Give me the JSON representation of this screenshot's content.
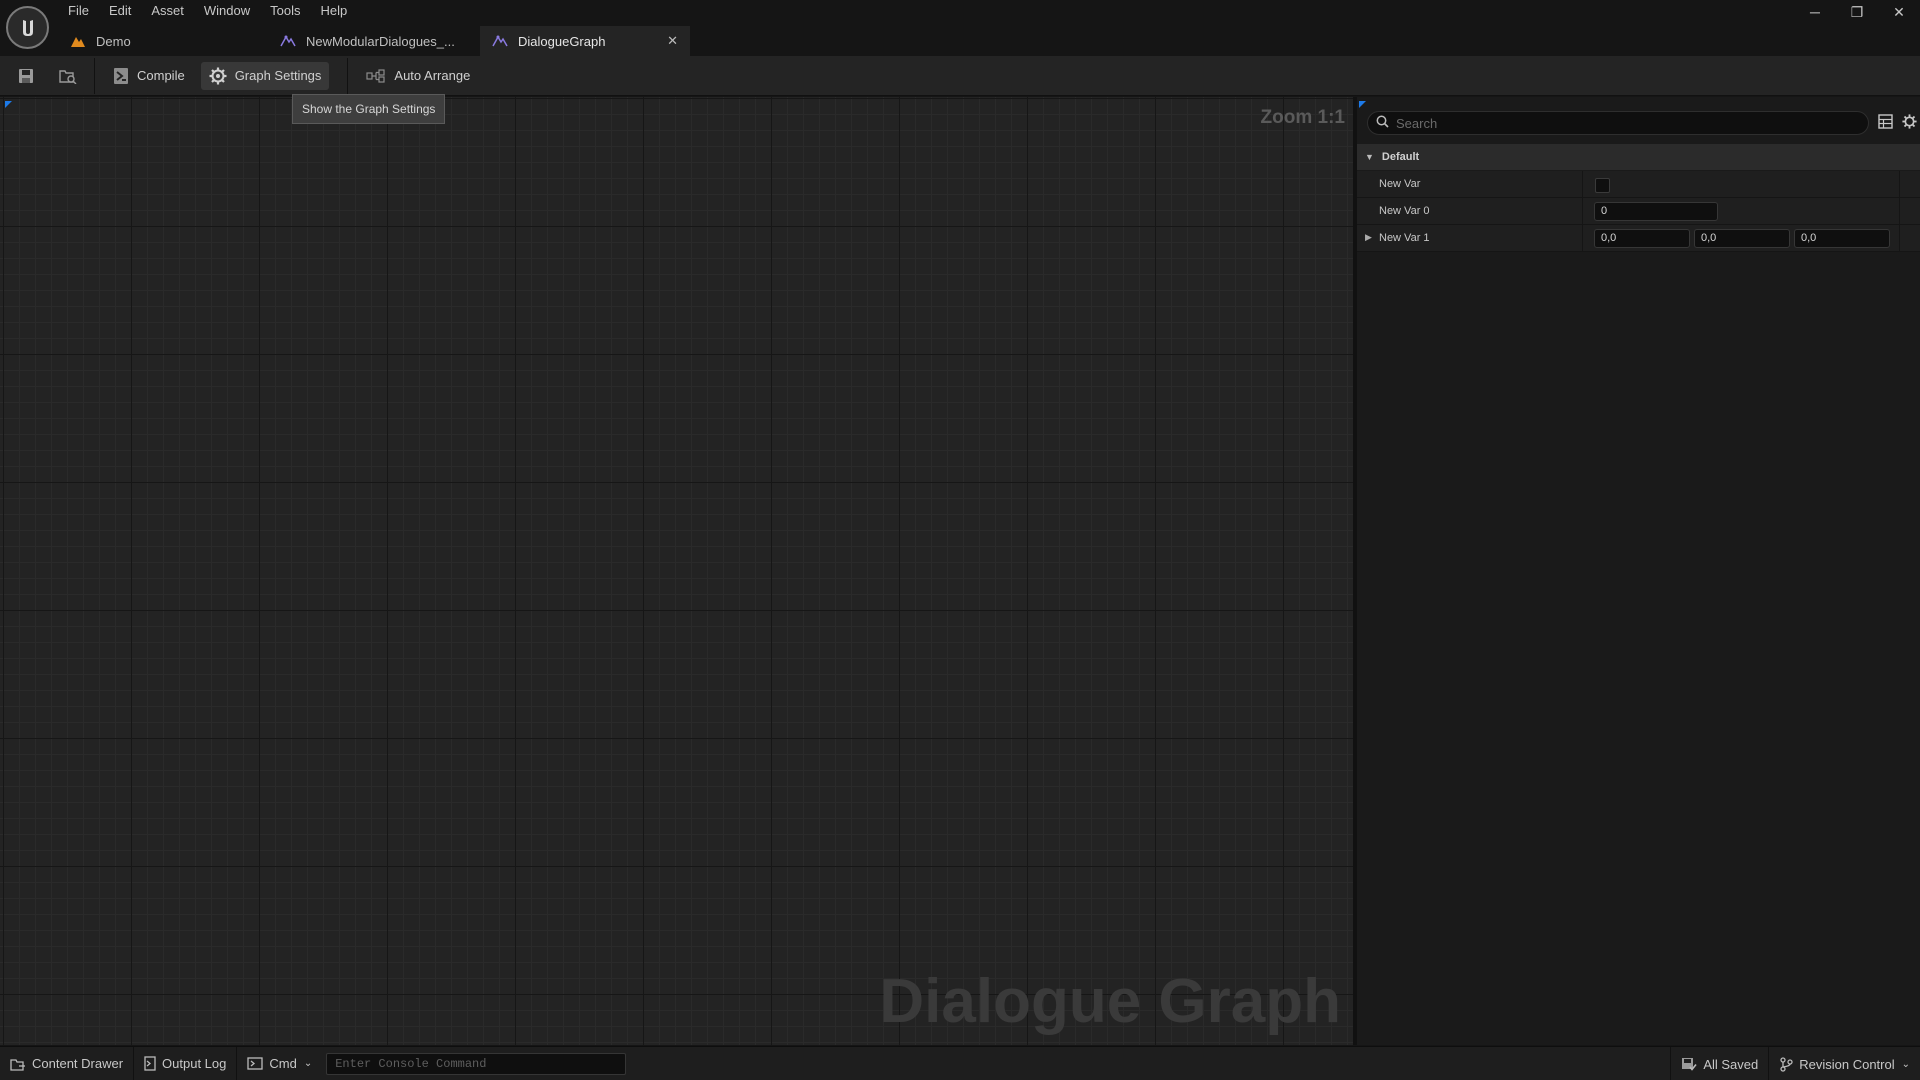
{
  "menubar": {
    "items": [
      "File",
      "Edit",
      "Asset",
      "Window",
      "Tools",
      "Help"
    ]
  },
  "tabs": [
    {
      "label": "Demo",
      "icon": "level-icon"
    },
    {
      "label": "NewModularDialogues_...",
      "icon": "dialogue-asset-icon"
    },
    {
      "label": "DialogueGraph",
      "icon": "dialogue-asset-icon",
      "active": true
    }
  ],
  "toolbar": {
    "compile_label": "Compile",
    "graph_settings_label": "Graph Settings",
    "auto_arrange_label": "Auto Arrange",
    "tooltip": "Show the Graph Settings"
  },
  "graph": {
    "zoom": "Zoom 1:1",
    "watermark": "Dialogue Graph"
  },
  "details": {
    "search_placeholder": "Search",
    "category": "Default",
    "properties": [
      {
        "name": "New Var",
        "type": "bool",
        "value": false
      },
      {
        "name": "New Var 0",
        "type": "int",
        "value": "0"
      },
      {
        "name": "New Var 1",
        "type": "vector",
        "values": [
          "0,0",
          "0,0",
          "0,0"
        ]
      }
    ]
  },
  "statusbar": {
    "content_drawer": "Content Drawer",
    "output_log": "Output Log",
    "cmd": "Cmd",
    "console_placeholder": "Enter Console Command",
    "all_saved": "All Saved",
    "revision_control": "Revision Control"
  },
  "colors": {
    "accent": "#1d7ae8",
    "background": "#151515",
    "panel": "#242424",
    "level_icon": "#e08a1e",
    "dialogue_icon": "#8a7ae0"
  }
}
